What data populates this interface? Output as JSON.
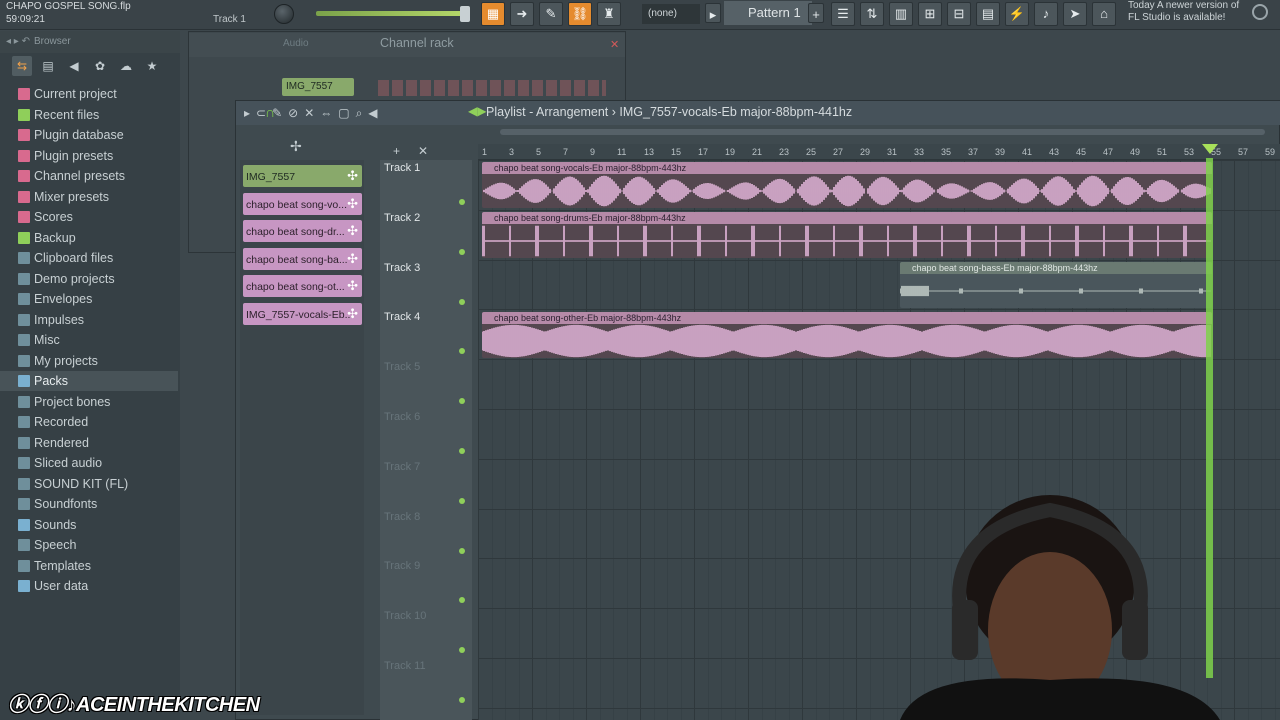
{
  "header": {
    "project_title": "CHAPO GOSPEL SONG.flp",
    "time": "59:09:21",
    "current_track": "Track 1",
    "pattern_dropdown": "(none)",
    "pattern_name": "Pattern 1",
    "update_notice_line1": "Today A newer version of",
    "update_notice_line2": "FL Studio is available!"
  },
  "browser": {
    "title": "Browser",
    "items": [
      {
        "label": "Current project",
        "icon": "project-icon",
        "color": "#d86a8e"
      },
      {
        "label": "Recent files",
        "icon": "recent-icon",
        "color": "#8fcf5a"
      },
      {
        "label": "Plugin database",
        "icon": "plugin-db-icon",
        "color": "#d86a8e"
      },
      {
        "label": "Plugin presets",
        "icon": "plugin-preset-icon",
        "color": "#d86a8e"
      },
      {
        "label": "Channel presets",
        "icon": "channel-preset-icon",
        "color": "#d86a8e"
      },
      {
        "label": "Mixer presets",
        "icon": "mixer-preset-icon",
        "color": "#d86a8e"
      },
      {
        "label": "Scores",
        "icon": "scores-icon",
        "color": "#d86a8e"
      },
      {
        "label": "Backup",
        "icon": "backup-icon",
        "color": "#8fcf5a"
      },
      {
        "label": "Clipboard files",
        "icon": "folder-icon",
        "color": "#6f8f9b"
      },
      {
        "label": "Demo projects",
        "icon": "folder-icon",
        "color": "#6f8f9b"
      },
      {
        "label": "Envelopes",
        "icon": "folder-icon",
        "color": "#6f8f9b"
      },
      {
        "label": "Impulses",
        "icon": "folder-icon",
        "color": "#6f8f9b"
      },
      {
        "label": "Misc",
        "icon": "folder-icon",
        "color": "#6f8f9b"
      },
      {
        "label": "My projects",
        "icon": "folder-icon",
        "color": "#6f8f9b"
      },
      {
        "label": "Packs",
        "icon": "packs-icon",
        "color": "#7ab0d0",
        "selected": true
      },
      {
        "label": "Project bones",
        "icon": "folder-icon",
        "color": "#6f8f9b"
      },
      {
        "label": "Recorded",
        "icon": "folder-icon",
        "color": "#6f8f9b"
      },
      {
        "label": "Rendered",
        "icon": "folder-icon",
        "color": "#6f8f9b"
      },
      {
        "label": "Sliced audio",
        "icon": "folder-icon",
        "color": "#6f8f9b"
      },
      {
        "label": "SOUND KIT (FL)",
        "icon": "folder-icon",
        "color": "#6f8f9b"
      },
      {
        "label": "Soundfonts",
        "icon": "folder-icon",
        "color": "#6f8f9b"
      },
      {
        "label": "Sounds",
        "icon": "sounds-icon",
        "color": "#7ab0d0"
      },
      {
        "label": "Speech",
        "icon": "speech-icon",
        "color": "#6f8f9b"
      },
      {
        "label": "Templates",
        "icon": "folder-icon",
        "color": "#6f8f9b"
      },
      {
        "label": "User data",
        "icon": "user-icon",
        "color": "#7ab0d0"
      }
    ]
  },
  "channel_rack": {
    "title": "Channel rack",
    "filter": "Audio",
    "channel_name": "IMG_7557"
  },
  "playlist": {
    "title": "Playlist - Arrangement",
    "pattern": "IMG_7557-vocals-Eb major-88bpm-441hz",
    "patterns": [
      {
        "label": "IMG_7557",
        "color": "a"
      },
      {
        "label": "chapo beat song-vo...",
        "color": "b"
      },
      {
        "label": "chapo beat song-dr...",
        "color": "b"
      },
      {
        "label": "chapo beat song-ba...",
        "color": "b"
      },
      {
        "label": "chapo beat song-ot...",
        "color": "b"
      },
      {
        "label": "IMG_7557-vocals-Eb...",
        "color": "b"
      }
    ],
    "ruler": [
      "1",
      "3",
      "5",
      "7",
      "9",
      "11",
      "13",
      "15",
      "17",
      "19",
      "21",
      "23",
      "25",
      "27",
      "29",
      "31",
      "33",
      "35",
      "37",
      "39",
      "41",
      "43",
      "45",
      "47",
      "49",
      "51",
      "53",
      "55",
      "57",
      "59"
    ],
    "tracks": [
      "Track 1",
      "Track 2",
      "Track 3",
      "Track 4",
      "Track 5",
      "Track 6",
      "Track 7",
      "Track 8",
      "Track 9",
      "Track 10",
      "Track 11"
    ],
    "clips": [
      {
        "label": "chapo beat song-vocals-Eb major-88bpm-443hz",
        "track": 0
      },
      {
        "label": "chapo beat song-drums-Eb major-88bpm-443hz",
        "track": 1
      },
      {
        "label": "chapo beat song-bass-Eb major-88bpm-443hz",
        "track": 2
      },
      {
        "label": "chapo beat song-other-Eb major-88bpm-443hz",
        "track": 3
      }
    ]
  },
  "watermark": "ACEINTHEKITCHEN"
}
